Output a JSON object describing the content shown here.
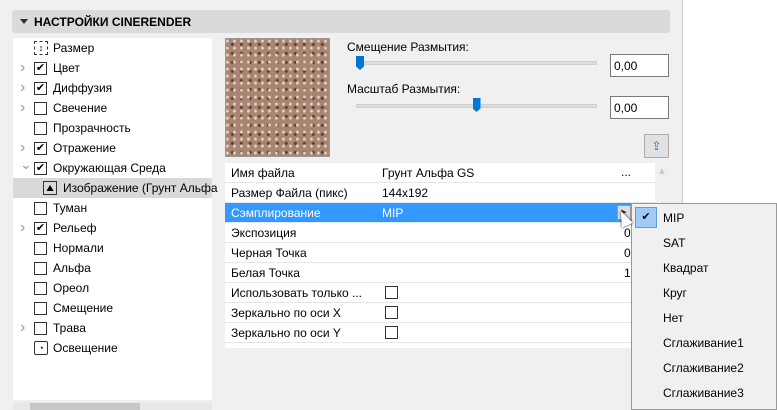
{
  "header": {
    "title": "НАСТРОЙКИ CINERENDER"
  },
  "tree": [
    {
      "label": "Размер",
      "kind": "icon-size",
      "chevron": ""
    },
    {
      "label": "Цвет",
      "kind": "check",
      "checked": true,
      "chevron": ">"
    },
    {
      "label": "Диффузия",
      "kind": "check",
      "checked": true,
      "chevron": ">"
    },
    {
      "label": "Свечение",
      "kind": "check",
      "checked": false,
      "chevron": ">"
    },
    {
      "label": "Прозрачность",
      "kind": "check",
      "checked": false,
      "chevron": ""
    },
    {
      "label": "Отражение",
      "kind": "check",
      "checked": true,
      "chevron": ">"
    },
    {
      "label": "Окружающая Среда",
      "kind": "check",
      "checked": true,
      "chevron": "v"
    },
    {
      "label": "Изображение (Грунт Альфа",
      "kind": "icon-image",
      "chevron": "",
      "selected": true
    },
    {
      "label": "Туман",
      "kind": "check",
      "checked": false,
      "chevron": ""
    },
    {
      "label": "Рельеф",
      "kind": "check",
      "checked": true,
      "chevron": ">"
    },
    {
      "label": "Нормали",
      "kind": "check",
      "checked": false,
      "chevron": ""
    },
    {
      "label": "Альфа",
      "kind": "check",
      "checked": false,
      "chevron": ""
    },
    {
      "label": "Ореол",
      "kind": "check",
      "checked": false,
      "chevron": ""
    },
    {
      "label": "Смещение",
      "kind": "check",
      "checked": false,
      "chevron": ""
    },
    {
      "label": "Трава",
      "kind": "check",
      "checked": false,
      "chevron": ">"
    },
    {
      "label": "Освещение",
      "kind": "icon-light",
      "chevron": ""
    }
  ],
  "blur_offset": {
    "label": "Смещение Размытия:",
    "value": "0,00",
    "slider_fraction": 0.0
  },
  "blur_scale": {
    "label": "Масштаб Размытия:",
    "value": "0,00",
    "slider_fraction": 0.5
  },
  "props": [
    {
      "name": "Имя файла",
      "value": "Грунт Альфа GS",
      "extra": "..."
    },
    {
      "name": "Размер Файла (пикс)",
      "value": "144x192"
    },
    {
      "name": "Сэмплирование",
      "value": "MIP",
      "highlight": true
    },
    {
      "name": "Экспозиция",
      "value": "",
      "edge": "0"
    },
    {
      "name": "Черная Точка",
      "value": "",
      "edge": "0"
    },
    {
      "name": "Белая Точка",
      "value": "",
      "edge": "1"
    },
    {
      "name": "Использовать только ...",
      "checkbox": false
    },
    {
      "name": "Зеркально по оси X",
      "checkbox": false
    },
    {
      "name": "Зеркально по оси Y",
      "checkbox": false
    }
  ],
  "menu": {
    "selected": "MIP",
    "items": [
      "MIP",
      "SAT",
      "Квадрат",
      "Круг",
      "Нет",
      "Сглаживание1",
      "Сглаживание2",
      "Сглаживание3"
    ]
  },
  "colors": {
    "accent": "#0078d7",
    "highlight": "#3399ff"
  }
}
